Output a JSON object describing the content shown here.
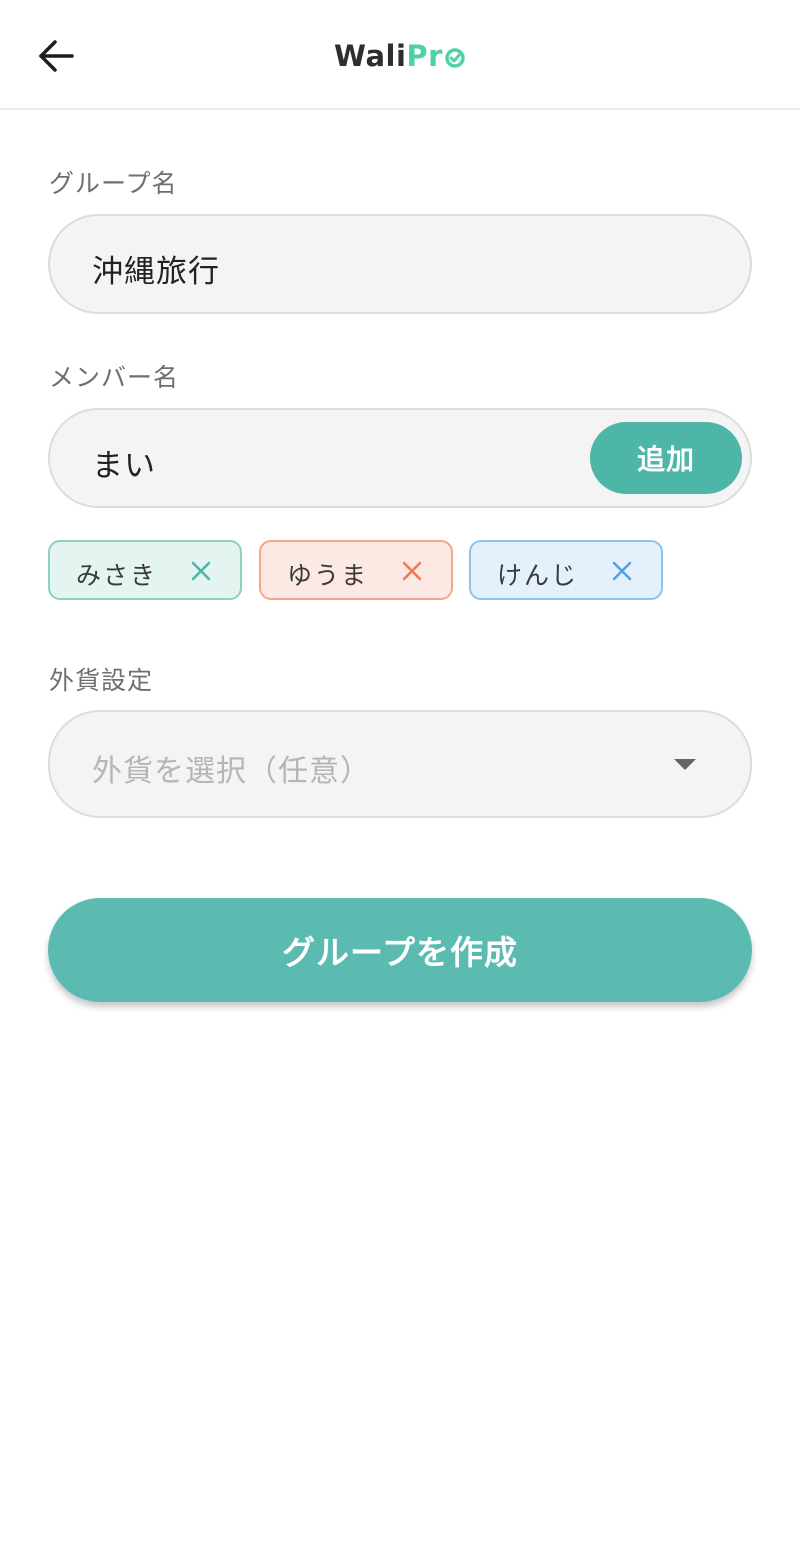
{
  "header": {
    "logo_part1": "Wali",
    "logo_part2": "Pr",
    "back_icon": "arrow-left-icon"
  },
  "group_name": {
    "label": "グループ名",
    "value": "沖縄旅行"
  },
  "member_name": {
    "label": "メンバー名",
    "value": "まい",
    "add_label": "追加"
  },
  "members": [
    {
      "name": "みさき",
      "bg": "#e4f4f1",
      "border": "#8fcfc6",
      "x_color": "#4db6a7"
    },
    {
      "name": "ゆうま",
      "bg": "#fde9e3",
      "border": "#f3a58d",
      "x_color": "#ee7a56"
    },
    {
      "name": "けんじ",
      "bg": "#e4f1fc",
      "border": "#8cc2ec",
      "x_color": "#4fa3e6"
    }
  ],
  "currency": {
    "label": "外貨設定",
    "placeholder": "外貨を選択（任意）"
  },
  "create_button": {
    "label": "グループを作成"
  },
  "colors": {
    "accent": "#4db6a7",
    "create_button": "#5bbbb1",
    "logo_green": "#4fd1a5"
  }
}
